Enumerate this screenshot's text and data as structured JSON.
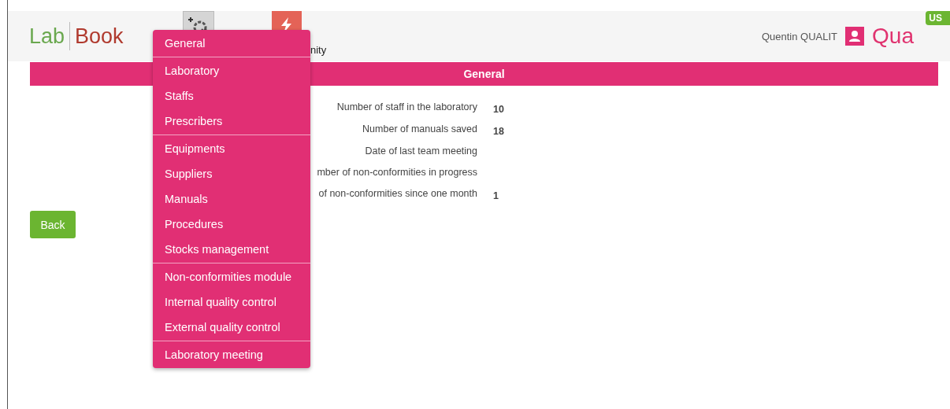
{
  "header": {
    "logo_left": "Lab",
    "logo_right": "Book",
    "partial_label": "nity",
    "user_name": "Quentin QUALIT",
    "user_brand": "Qua",
    "language": "US"
  },
  "section_title": "General",
  "stats": [
    {
      "label": "Number of staff in the laboratory",
      "value": "10"
    },
    {
      "label": "Number of manuals saved",
      "value": "18"
    },
    {
      "label": "Date of last team meeting"
    },
    {
      "label": "mber of non-conformities in progress"
    },
    {
      "label": "of non-conformities since one month",
      "value": "1"
    }
  ],
  "back_button": "Back",
  "menu": {
    "groups": [
      [
        "General"
      ],
      [
        "Laboratory",
        "Staffs",
        "Prescribers"
      ],
      [
        "Equipments",
        "Suppliers",
        "Manuals",
        "Procedures",
        "Stocks management"
      ],
      [
        "Non-conformities module",
        "Internal quality control",
        "External quality control"
      ],
      [
        "Laboratory meeting"
      ]
    ]
  }
}
